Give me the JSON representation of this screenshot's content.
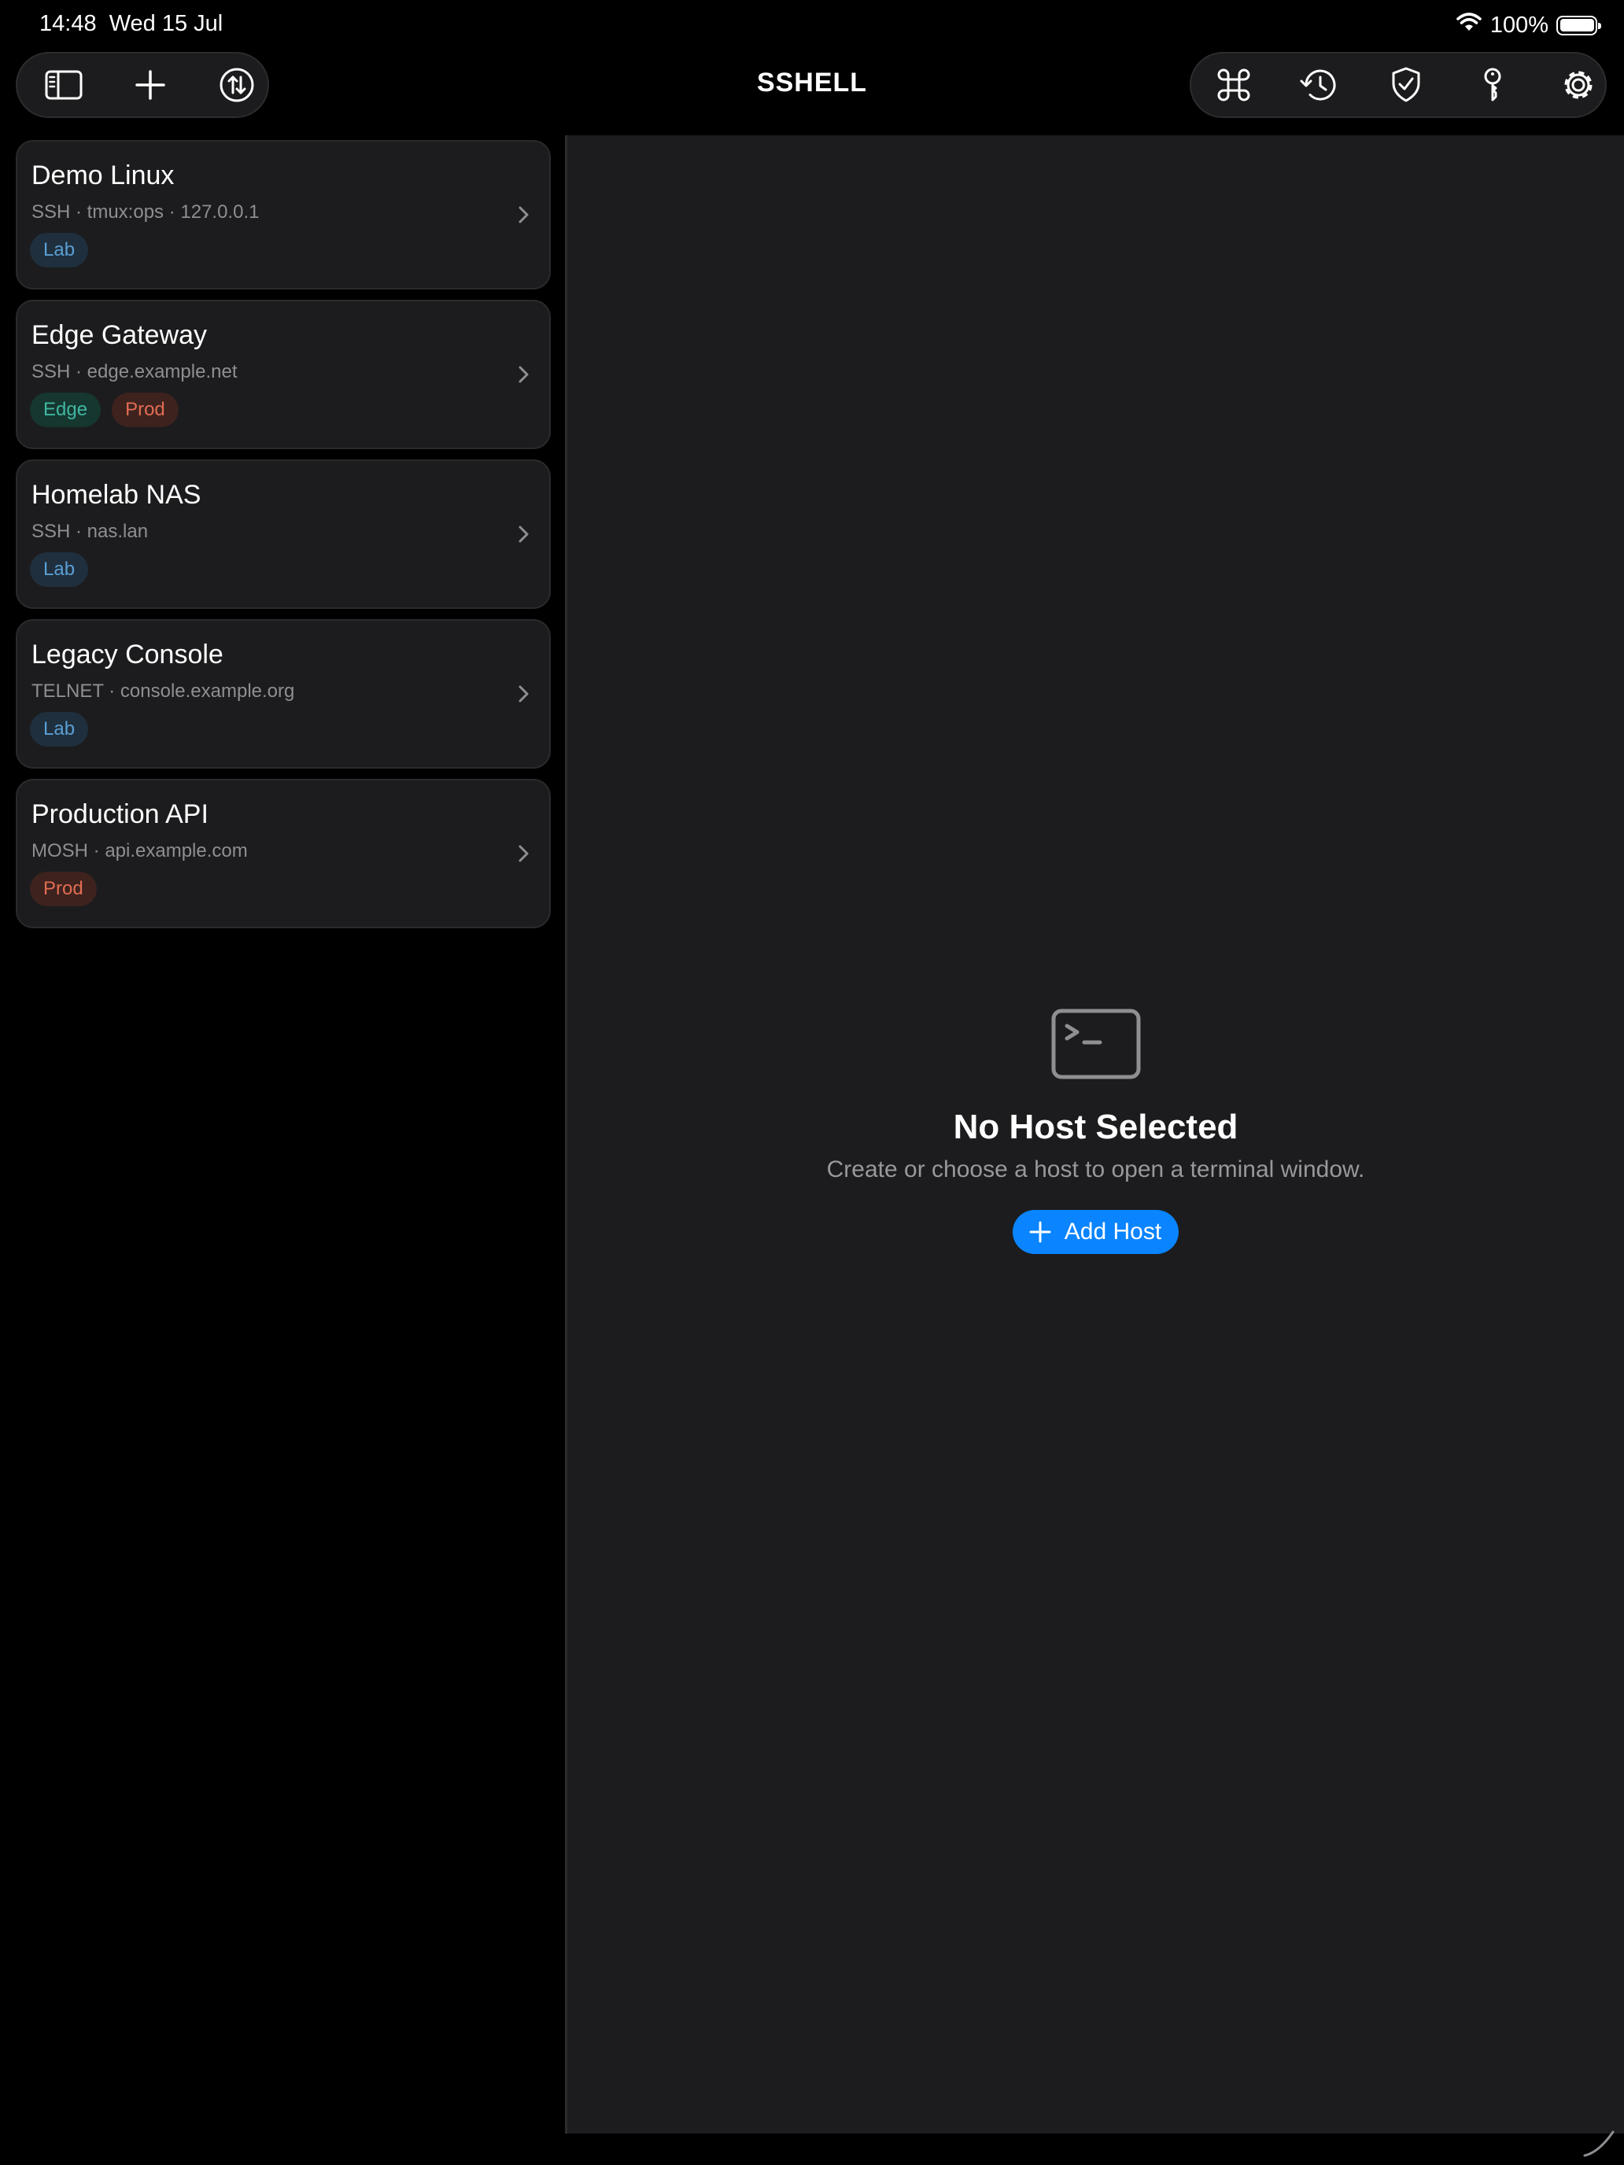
{
  "status_bar": {
    "time": "14:48",
    "date": "Wed 15 Jul",
    "battery": "100%"
  },
  "toolbar": {
    "title": "SSHELL",
    "left_icons": [
      "sidebar-toggle-icon",
      "plus-icon",
      "sync-icon"
    ],
    "right_icons": [
      "command-icon",
      "history-icon",
      "shield-check-icon",
      "key-icon",
      "gear-icon"
    ]
  },
  "hosts": [
    {
      "name": "Demo Linux",
      "subtitle": "SSH · tmux:ops · 127.0.0.1",
      "tags": [
        "Lab"
      ]
    },
    {
      "name": "Edge Gateway",
      "subtitle": "SSH · edge.example.net",
      "tags": [
        "Edge",
        "Prod"
      ]
    },
    {
      "name": "Homelab NAS",
      "subtitle": "SSH · nas.lan",
      "tags": [
        "Lab"
      ]
    },
    {
      "name": "Legacy Console",
      "subtitle": "TELNET · console.example.org",
      "tags": [
        "Lab"
      ]
    },
    {
      "name": "Production API",
      "subtitle": "MOSH · api.example.com",
      "tags": [
        "Prod"
      ]
    }
  ],
  "empty_state": {
    "title": "No Host Selected",
    "description": "Create or choose a host to open a terminal window.",
    "button_label": "Add Host"
  },
  "colors": {
    "accent": "#0a84ff",
    "tag_lab": "#5b9fd4",
    "tag_edge": "#3fb7a0",
    "tag_prod": "#e26d52"
  }
}
